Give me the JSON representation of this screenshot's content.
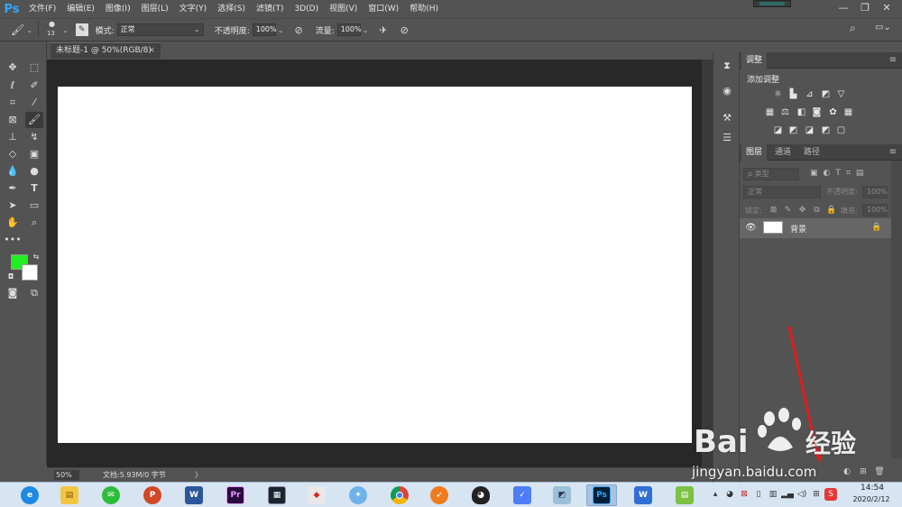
{
  "app": {
    "logo": "Ps",
    "menus": [
      "文件(F)",
      "编辑(E)",
      "图像(I)",
      "图层(L)",
      "文字(Y)",
      "选择(S)",
      "滤镜(T)",
      "3D(D)",
      "视图(V)",
      "窗口(W)",
      "帮助(H)"
    ],
    "window_controls": {
      "minimize": "—",
      "restore": "❐",
      "close": "✕"
    }
  },
  "options": {
    "brush_size": "13",
    "mode_label": "模式:",
    "mode_value": "正常",
    "opacity_label": "不透明度:",
    "opacity_value": "100%",
    "flow_label": "流量:",
    "flow_value": "100%"
  },
  "document": {
    "tab_title": "未标题-1 @ 50%(RGB/8)",
    "tab_close": "×",
    "zoom": "50%",
    "doc_info": "文档:5.93M/0 字节",
    "status_arrow": "〉"
  },
  "colors": {
    "foreground": "#22ee22",
    "background": "#ffffff",
    "accent_ps": "#31a8ff",
    "annotation_arrow": "#e21c1c"
  },
  "adjustments_panel": {
    "tab": "调整",
    "title": "添加调整",
    "icons_row1": [
      "brightness-icon",
      "levels-icon",
      "curves-icon",
      "exposure-icon",
      "vibrance-icon"
    ],
    "icons_row2": [
      "hue-saturation-icon",
      "color-balance-icon",
      "black-white-icon",
      "photo-filter-icon",
      "channel-mixer-icon",
      "color-lookup-icon"
    ],
    "icons_row3": [
      "invert-icon",
      "posterize-icon",
      "threshold-icon",
      "gradient-map-icon",
      "selective-color-icon"
    ]
  },
  "layers_panel": {
    "tabs": [
      "图层",
      "通道",
      "路径"
    ],
    "filter_placeholder": "ρ 类型",
    "blend_mode": "正常",
    "opacity_label": "不透明度:",
    "opacity_value": "100%",
    "lock_label": "锁定:",
    "fill_label": "填充:",
    "fill_value": "100%",
    "layers": [
      {
        "name": "背景",
        "visible": true,
        "locked": true
      }
    ]
  },
  "taskbar": {
    "apps": [
      "ie",
      "explorer",
      "wechat",
      "powerpoint",
      "word",
      "premiere",
      "video-editor",
      "app-red",
      "app-bird",
      "chrome",
      "app-orange",
      "qq",
      "app-feishu",
      "app-blue",
      "photoshop",
      "wps",
      "app-notes"
    ],
    "clock_time": "14:54",
    "clock_date": "2020/2/12"
  },
  "watermark": {
    "brand_prefix": "Bai",
    "brand_suffix": "经验",
    "url": "jingyan.baidu.com"
  }
}
